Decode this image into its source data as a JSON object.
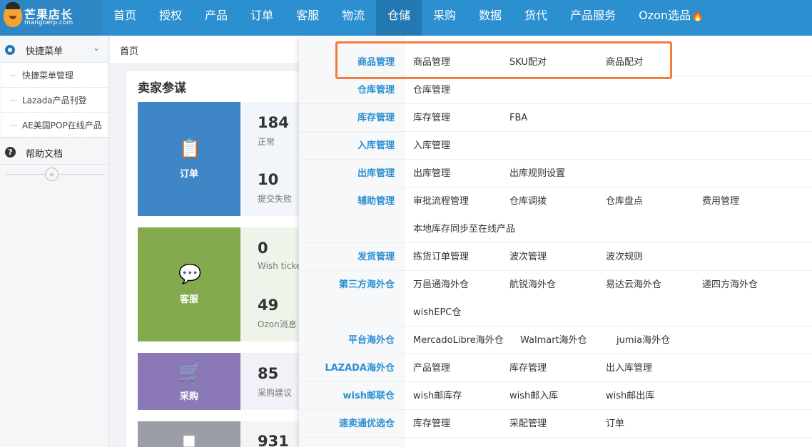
{
  "brand": {
    "name": "芒果店长",
    "sub": "mangoerp.com"
  },
  "nav": [
    {
      "label": "首页"
    },
    {
      "label": "授权"
    },
    {
      "label": "产品"
    },
    {
      "label": "订单"
    },
    {
      "label": "客服"
    },
    {
      "label": "物流"
    },
    {
      "label": "仓储"
    },
    {
      "label": "采购"
    },
    {
      "label": "数据"
    },
    {
      "label": "货代"
    },
    {
      "label": "产品服务"
    },
    {
      "label": "Ozon选品"
    }
  ],
  "sidebar": {
    "quick_menu_label": "快捷菜单",
    "items": [
      {
        "label": "快捷菜单管理"
      },
      {
        "label": "Lazada产品刊登"
      },
      {
        "label": "AE美国POP在线产品"
      }
    ],
    "help_label": "帮助文档",
    "collapse_glyph": "«"
  },
  "breadcrumb": {
    "home": "首页"
  },
  "panel": {
    "title": "卖家参谋",
    "cards": [
      {
        "label": "订单",
        "stats": [
          {
            "value": "184",
            "label": "正常"
          },
          {
            "value": "10",
            "label": "提交失败"
          }
        ]
      },
      {
        "label": "客服",
        "stats": [
          {
            "value": "0",
            "label": "Wish ticke"
          },
          {
            "value": "49",
            "label": "Ozon消息"
          }
        ]
      },
      {
        "label": "采购",
        "stats": [
          {
            "value": "85",
            "label": "采购建议"
          }
        ]
      },
      {
        "label": "",
        "stats": [
          {
            "value": "931",
            "label": ""
          }
        ]
      }
    ]
  },
  "dropdown": {
    "rows": [
      {
        "category": "商品管理",
        "items": [
          "商品管理",
          "SKU配对",
          "商品配对"
        ]
      },
      {
        "category": "仓库管理",
        "items": [
          "仓库管理"
        ]
      },
      {
        "category": "库存管理",
        "items": [
          "库存管理",
          "FBA"
        ]
      },
      {
        "category": "入库管理",
        "items": [
          "入库管理"
        ]
      },
      {
        "category": "出库管理",
        "items": [
          "出库管理",
          "出库规则设置"
        ]
      },
      {
        "category": "辅助管理",
        "items": [
          "审批流程管理",
          "仓库调拨",
          "仓库盘点",
          "费用管理",
          "本地库存同步至在线产品"
        ]
      },
      {
        "category": "发货管理",
        "items": [
          "拣货订单管理",
          "波次管理",
          "波次规则"
        ]
      },
      {
        "category": "第三方海外仓",
        "items": [
          "万邑通海外仓",
          "航锐海外仓",
          "易达云海外仓",
          "递四方海外仓",
          "wishEPC仓"
        ]
      },
      {
        "category": "平台海外仓",
        "items": [
          "MercadoLibre海外仓",
          "Walmart海外仓",
          "jumia海外仓"
        ]
      },
      {
        "category": "LAZADA海外仓",
        "items": [
          "产品管理",
          "库存管理",
          "出入库管理"
        ]
      },
      {
        "category": "wish邮联仓",
        "items": [
          "wish邮库存",
          "wish邮入库",
          "wish邮出库"
        ]
      },
      {
        "category": "速卖通优选仓",
        "items": [
          "库存管理",
          "采配管理",
          "订单"
        ]
      }
    ]
  }
}
